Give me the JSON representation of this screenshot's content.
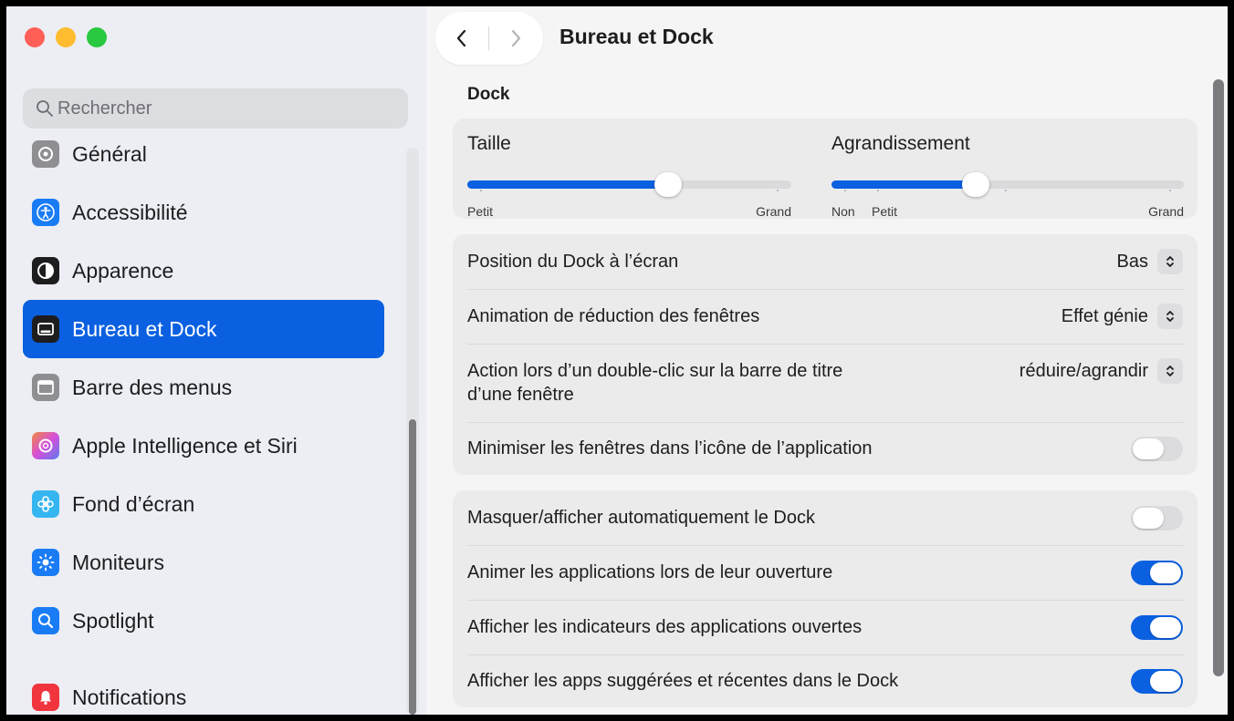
{
  "sidebar": {
    "search_placeholder": "Rechercher",
    "items": [
      {
        "label": "Général",
        "icon": "gear-icon",
        "color": "#8e8e93"
      },
      {
        "label": "Accessibilité",
        "icon": "accessibility-icon",
        "color": "#1a7cf5"
      },
      {
        "label": "Apparence",
        "icon": "appearance-icon",
        "color": "#1d1d1f"
      },
      {
        "label": "Bureau et Dock",
        "icon": "dock-icon",
        "color": "#1d1d1f",
        "selected": true
      },
      {
        "label": "Barre des menus",
        "icon": "menubar-icon",
        "color": "#8e8e93"
      },
      {
        "label": "Apple Intelligence et Siri",
        "icon": "siri-icon",
        "color": "#c452e6"
      },
      {
        "label": "Fond d’écran",
        "icon": "wallpaper-icon",
        "color": "#35b6f0"
      },
      {
        "label": "Moniteurs",
        "icon": "display-icon",
        "color": "#1a7cf5"
      },
      {
        "label": "Spotlight",
        "icon": "spotlight-icon",
        "color": "#1a7cf5"
      },
      {
        "label": "Notifications",
        "icon": "notifications-icon",
        "color": "#f0353e"
      }
    ]
  },
  "header": {
    "title": "Bureau et Dock"
  },
  "dock": {
    "section_title": "Dock",
    "size": {
      "label": "Taille",
      "min": "Petit",
      "max": "Grand",
      "value": 0.62
    },
    "magnification": {
      "label": "Agrandissement",
      "off": "Non",
      "min": "Petit",
      "max": "Grand",
      "value": 0.41
    },
    "position": {
      "label": "Position du Dock à l’écran",
      "value": "Bas"
    },
    "minimize_effect": {
      "label": "Animation de réduction des fenêtres",
      "value": "Effet génie"
    },
    "double_click": {
      "label_line1": "Action lors d’un double-clic sur la barre de titre",
      "label_line2": "d’une fenêtre",
      "value": "réduire/agrandir"
    },
    "minimize_into_app": {
      "label": "Minimiser les fenêtres dans l’icône de l’application",
      "on": false
    },
    "autohide": {
      "label": "Masquer/afficher automatiquement le Dock",
      "on": false
    },
    "animate_opening": {
      "label": "Animer les applications lors de leur ouverture",
      "on": true
    },
    "show_indicators": {
      "label": "Afficher les indicateurs des applications ouvertes",
      "on": true
    },
    "show_suggested": {
      "label": "Afficher les apps suggérées et récentes dans le Dock",
      "on": true
    }
  },
  "colors": {
    "accent": "#0a60e0",
    "sidebar_bg": "#eceef3",
    "card_bg": "#ebebec"
  }
}
